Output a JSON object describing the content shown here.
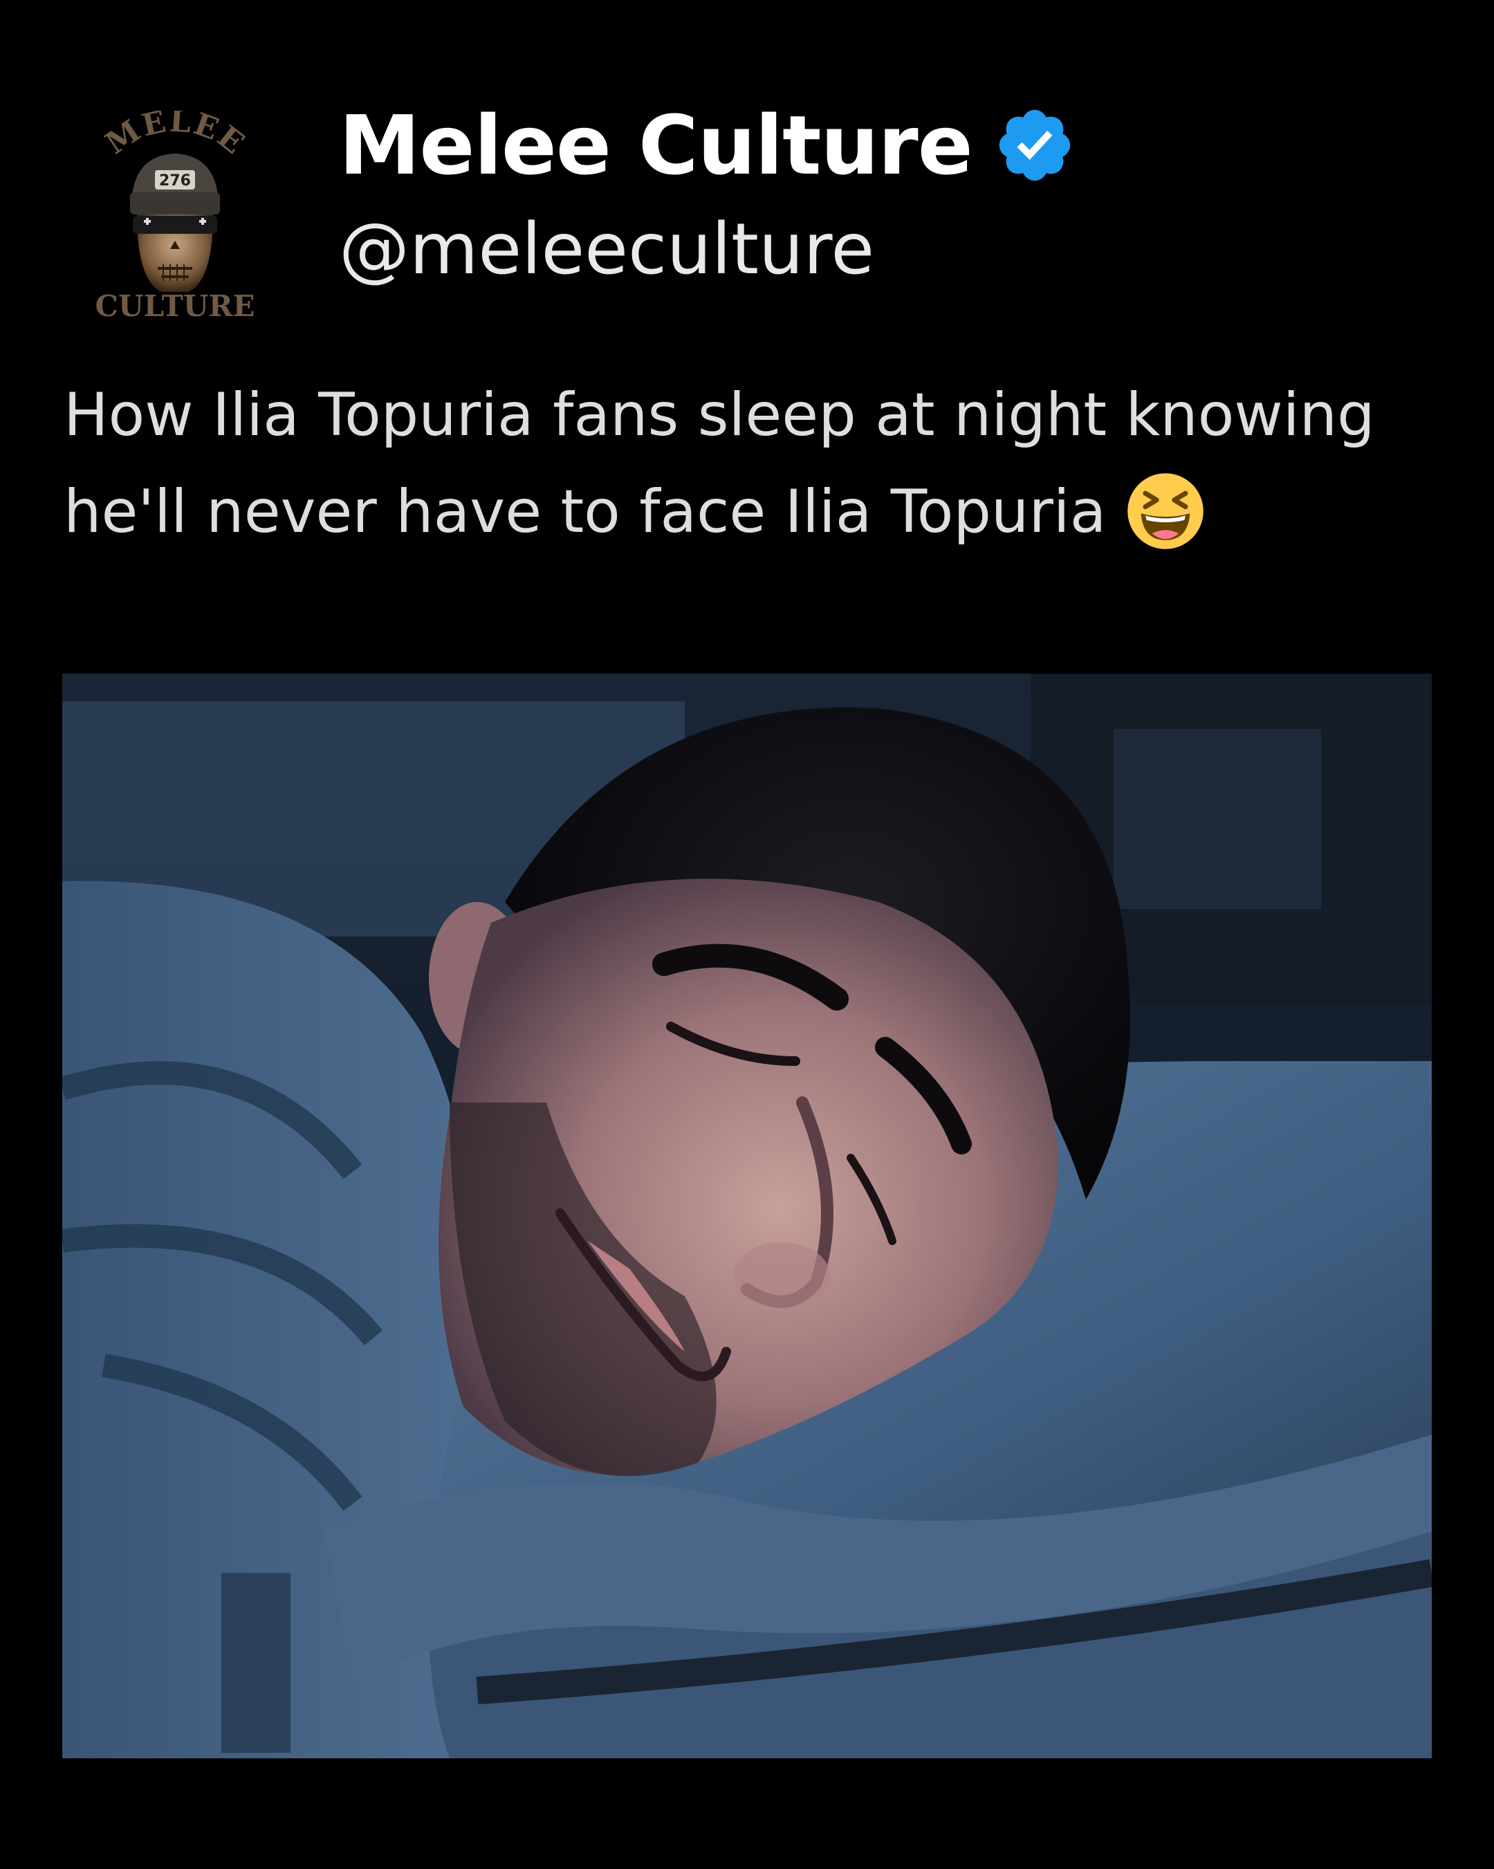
{
  "tweet": {
    "author": {
      "display_name": "Melee Culture",
      "handle": "@meleeculture",
      "verified": true,
      "avatar": {
        "logo_text_top": "MELEE",
        "logo_badge": "276",
        "logo_text_bottom": "CULTURE"
      }
    },
    "text": "How Ilia Topuria fans sleep at night knowing he'll never have to face Ilia Topuria",
    "emoji": "grinning-squinting-face-emoji",
    "media": {
      "icon": "photo-sleeping-man"
    }
  },
  "colors": {
    "background": "#000000",
    "name": "#ffffff",
    "text": "#dedede",
    "verified": "#1d9bf0"
  }
}
